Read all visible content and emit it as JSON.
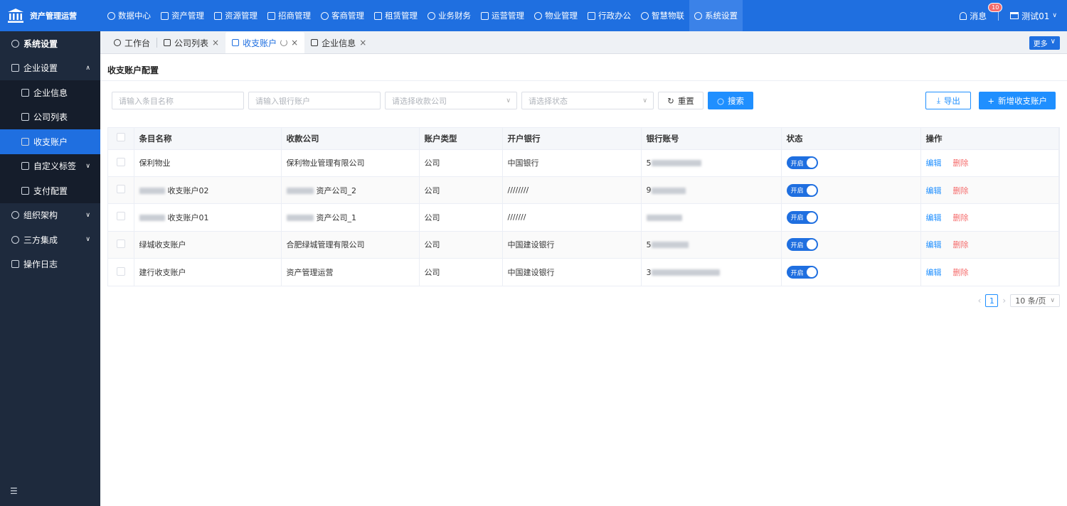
{
  "app": {
    "name": "资产管理运营"
  },
  "nav": [
    {
      "label": "数据中心",
      "icon": "clock-icon"
    },
    {
      "label": "资产管理",
      "icon": "cube-icon"
    },
    {
      "label": "资源管理",
      "icon": "building-icon"
    },
    {
      "label": "招商管理",
      "icon": "tag-icon"
    },
    {
      "label": "客商管理",
      "icon": "users-icon"
    },
    {
      "label": "租赁管理",
      "icon": "house-icon"
    },
    {
      "label": "业务财务",
      "icon": "coin-icon"
    },
    {
      "label": "运营管理",
      "icon": "chart-icon"
    },
    {
      "label": "物业管理",
      "icon": "home-icon"
    },
    {
      "label": "行政办公",
      "icon": "monitor-icon"
    },
    {
      "label": "智慧物联",
      "icon": "iot-icon"
    },
    {
      "label": "系统设置",
      "icon": "gear-icon",
      "active": true
    }
  ],
  "header": {
    "messages_label": "消息",
    "message_count": "10",
    "user_name": "测试01"
  },
  "sidebar": {
    "title": "系统设置",
    "groups": [
      {
        "label": "企业设置",
        "expanded": true
      },
      {
        "label": "企业信息"
      },
      {
        "label": "公司列表"
      },
      {
        "label": "收支账户",
        "active": true
      },
      {
        "label": "自定义标签"
      },
      {
        "label": "支付配置"
      },
      {
        "label": "组织架构"
      },
      {
        "label": "三方集成"
      },
      {
        "label": "操作日志"
      }
    ]
  },
  "tabs": [
    {
      "label": "工作台"
    },
    {
      "label": "公司列表"
    },
    {
      "label": "收支账户",
      "active": true
    },
    {
      "label": "企业信息"
    }
  ],
  "more_label": "更多",
  "page": {
    "title": "收支账户配置"
  },
  "filters": {
    "name_placeholder": "请输入条目名称",
    "account_placeholder": "请输入银行账户",
    "company_placeholder": "请选择收款公司",
    "status_placeholder": "请选择状态",
    "reset_label": "重置",
    "search_label": "搜索",
    "export_label": "导出",
    "add_label": "新增收支账户"
  },
  "table": {
    "columns": [
      "条目名称",
      "收款公司",
      "账户类型",
      "开户银行",
      "银行账号",
      "状态",
      "操作"
    ],
    "rows": [
      {
        "name": "保利物业",
        "company": "保利物业管理有限公司",
        "type": "公司",
        "bank": "中国银行",
        "account": "5",
        "status": "开启"
      },
      {
        "name": "收支账户02",
        "company": "资产公司_2",
        "type": "公司",
        "bank": "////////",
        "account": "9",
        "status": "开启"
      },
      {
        "name": "收支账户01",
        "company": "资产公司_1",
        "type": "公司",
        "bank": "///////",
        "account": "",
        "status": "开启"
      },
      {
        "name": "绿城收支账户",
        "company": "合肥绿城管理有限公司",
        "type": "公司",
        "bank": "中国建设银行",
        "account": "5",
        "status": "开启"
      },
      {
        "name": "建行收支账户",
        "company": "资产管理运营",
        "type": "公司",
        "bank": "中国建设银行",
        "account": "3",
        "status": "开启"
      }
    ],
    "edit_label": "编辑",
    "delete_label": "删除"
  },
  "pagination": {
    "current": "1",
    "page_size": "10 条/页"
  }
}
